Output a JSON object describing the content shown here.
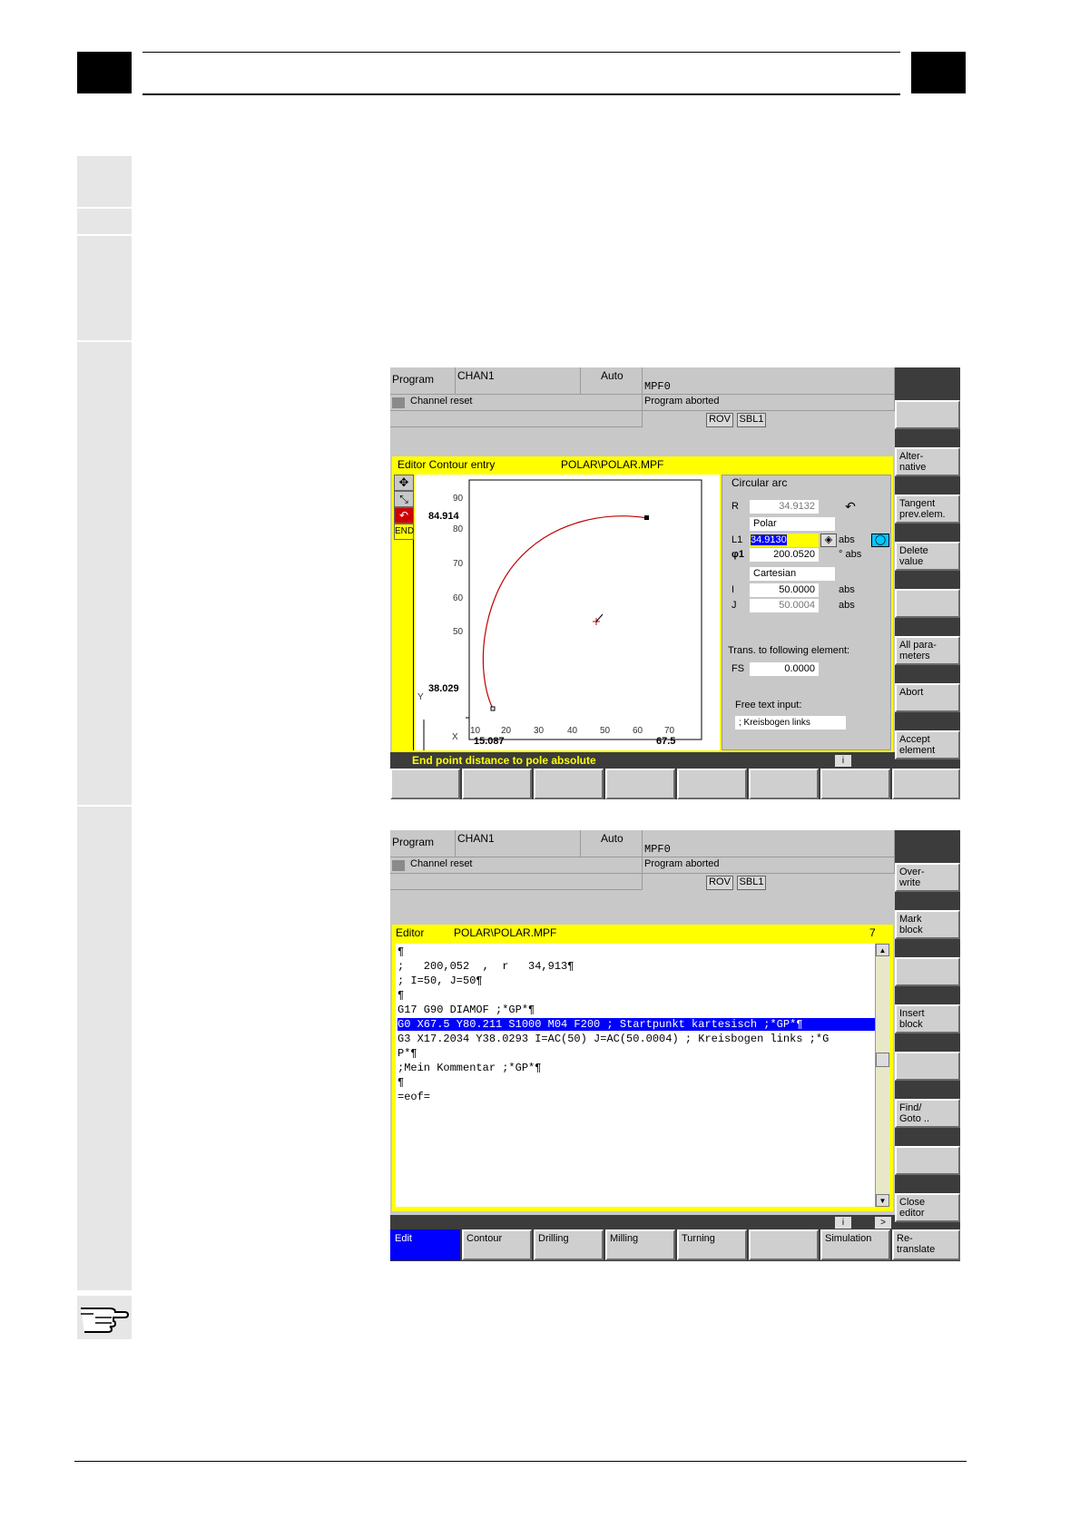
{
  "screen1": {
    "header": {
      "area": "Program",
      "channel": "CHAN1",
      "mode": "Auto",
      "program": "MPF0",
      "channel_status": "Channel reset",
      "program_status": "Program aborted",
      "flags": [
        "ROV",
        "SBL1"
      ]
    },
    "editor_bar": {
      "title": "Editor  Contour entry",
      "file": "POLAR\\POLAR.MPF"
    },
    "tools": [
      "END"
    ],
    "plot": {
      "y_ticks": [
        "90",
        "80",
        "70",
        "60",
        "50"
      ],
      "x_ticks": [
        "10",
        "20",
        "30",
        "40",
        "50",
        "60",
        "70"
      ],
      "y_axis_label": "Y",
      "x_axis_label": "X",
      "y_marker_top": "84.914",
      "y_marker_bottom": "38.029",
      "x_marker_left": "15.087",
      "x_marker_right": "67.5",
      "arc_color": "#c00000"
    },
    "form": {
      "section": "Circular arc",
      "r_label": "R",
      "r_value": "34.9132",
      "polar_label": "Polar",
      "l1_label": "L1",
      "l1_value": "34.9130",
      "l1_unit": "abs",
      "phi_label": "φ1",
      "phi_value": "200.0520",
      "phi_unit": "° abs",
      "cartesian_label": "Cartesian",
      "i_label": "I",
      "i_value": "50.0000",
      "i_unit": "abs",
      "j_label": "J",
      "j_value": "50.0004",
      "j_unit": "abs",
      "trans_label": "Trans. to following element:",
      "fs_label": "FS",
      "fs_value": "0.0000",
      "free_text_label": "Free text input:",
      "free_text_value": "; Kreisbogen links"
    },
    "status_message": "End point distance to pole absolute",
    "info_icon": "i",
    "vertical_softkeys": [
      "",
      "Alter-\nnative",
      "Tangent\nprev.elem.",
      "Delete\nvalue",
      "",
      "All para-\nmeters",
      "Abort",
      "Accept\nelement"
    ],
    "horizontal_softkeys": [
      "",
      "",
      "",
      "",
      "",
      "",
      "",
      ""
    ]
  },
  "screen2": {
    "header": {
      "area": "Program",
      "channel": "CHAN1",
      "mode": "Auto",
      "program": "MPF0",
      "channel_status": "Channel reset",
      "program_status": "Program aborted",
      "flags": [
        "ROV",
        "SBL1"
      ]
    },
    "editor_bar": {
      "title": "Editor",
      "file": "POLAR\\POLAR.MPF",
      "line_number": "7"
    },
    "code_lines": [
      "¶",
      ";   200,052  ,  r   34,913¶",
      "; I=50, J=50¶",
      "¶",
      "G17 G90 DIAMOF ;*GP*¶",
      "G0 X67.5 Y80.211 S1000 M04 F200 ; Startpunkt kartesisch ;*GP*¶",
      "G3 X17.2034 Y38.0293 I=AC(50) J=AC(50.0004) ; Kreisbogen links ;*G",
      "P*¶",
      ";Mein Kommentar ;*GP*¶",
      "¶",
      "=eof="
    ],
    "info_icon": "i",
    "next_icon": ">",
    "vertical_softkeys": [
      "Over-\nwrite",
      "Mark\nblock",
      "",
      "Insert\nblock",
      "",
      "Find/\nGoto ..",
      "",
      "Close\neditor"
    ],
    "horizontal_softkeys": [
      "Edit",
      "Contour",
      "Drilling",
      "Milling",
      "Turning",
      "",
      "Simulation",
      "Re-\ntranslate"
    ],
    "highlight_color": "#0000ff"
  }
}
